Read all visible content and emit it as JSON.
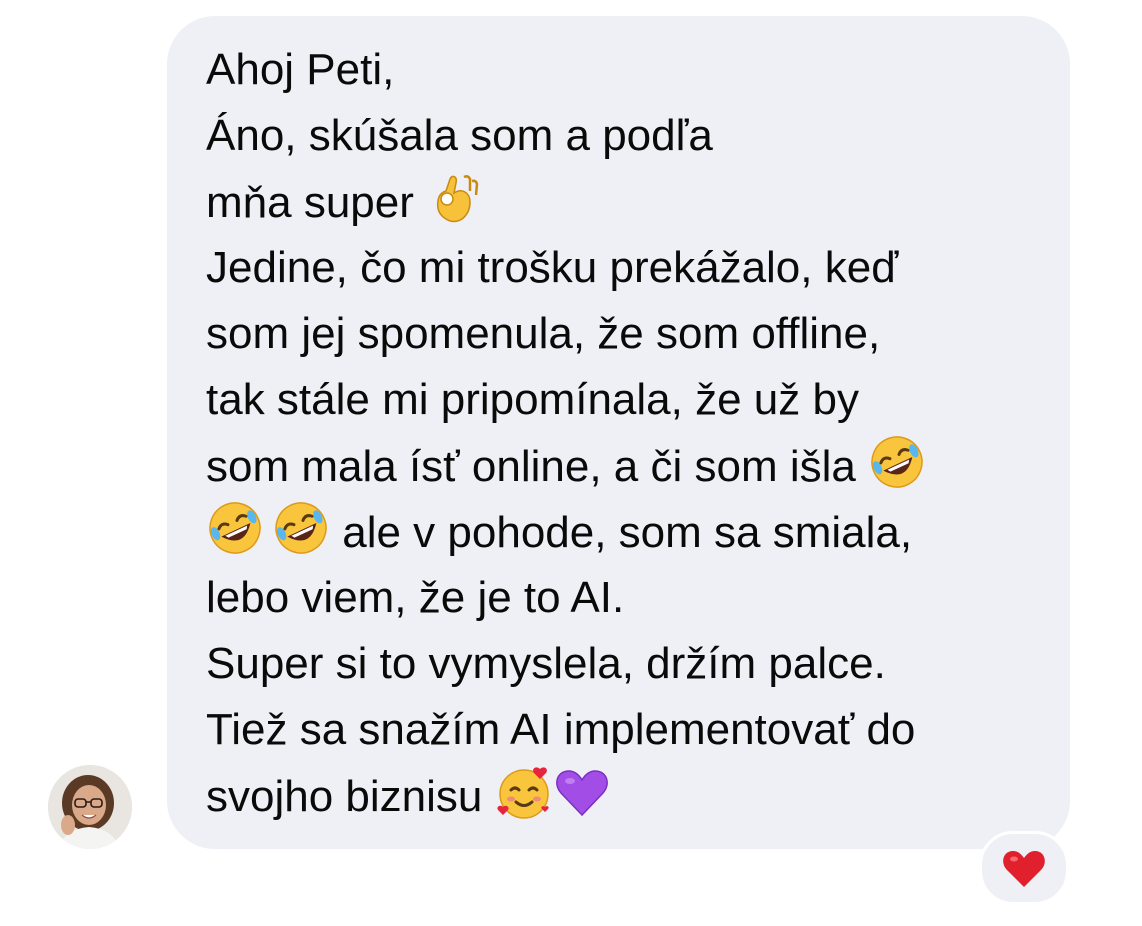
{
  "message": {
    "lines": [
      "Ahoj Peti,",
      "Áno, skúšala som a podľa",
      "mňa super",
      "Jedine, čo mi trošku prekážalo, keď",
      "som jej spomenula, že som offline,",
      "tak stále mi pripomínala, že už by",
      "som mala ísť online, a či som išla",
      "ale v pohode, som sa smiala,",
      "lebo viem, že je to AI.",
      "Super si to vymyslela, držím palce.",
      "Tiež sa snažím AI implementovať do",
      "svojho biznisu"
    ],
    "emojis": {
      "ok_hand": "ok-hand-emoji",
      "laughing": "rolling-on-floor-laughing-emoji",
      "smiling_hearts": "smiling-face-with-hearts-emoji",
      "purple_heart": "purple-heart-emoji"
    }
  },
  "sender": {
    "avatar": "avatar-photo"
  },
  "reaction": {
    "icon": "red-heart-icon",
    "color": "#e0202c"
  },
  "colors": {
    "bubble": "#eff0f5",
    "text": "#0a0a0a",
    "background": "#ffffff"
  }
}
